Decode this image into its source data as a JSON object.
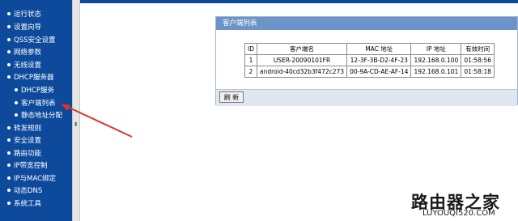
{
  "sidebar": {
    "items": [
      {
        "label": "运行状态"
      },
      {
        "label": "设置向导"
      },
      {
        "label": "QSS安全设置"
      },
      {
        "label": "网络参数"
      },
      {
        "label": "无线设置"
      },
      {
        "label": "DHCP服务器"
      },
      {
        "label": "DHCP服务"
      },
      {
        "label": "客户端列表"
      },
      {
        "label": "静态地址分配"
      },
      {
        "label": "转发规则"
      },
      {
        "label": "安全设置"
      },
      {
        "label": "路由功能"
      },
      {
        "label": "IP带宽控制"
      },
      {
        "label": "IP与MAC绑定"
      },
      {
        "label": "动态DNS"
      },
      {
        "label": "系统工具"
      }
    ]
  },
  "panel": {
    "title": "客户端列表",
    "refresh_label": "刷 新"
  },
  "table": {
    "headers": [
      "ID",
      "客户端名",
      "MAC 地址",
      "IP 地址",
      "有效时间"
    ],
    "rows": [
      [
        "1",
        "USER-20090101FR",
        "12-3F-3B-D2-4F-23",
        "192.168.0.100",
        "01:58:56"
      ],
      [
        "2",
        "android-40cd32b3f472c273",
        "00-9A-CD-AE-AF-14",
        "192.168.0.101",
        "01:58:18"
      ]
    ]
  },
  "watermark": {
    "cn": "路由器之家",
    "url": "LUYOUQI520.COM"
  },
  "colors": {
    "sidebar": "#0d4a9c",
    "panel_title": "#6d94c8",
    "arrow": "#d9362b"
  }
}
